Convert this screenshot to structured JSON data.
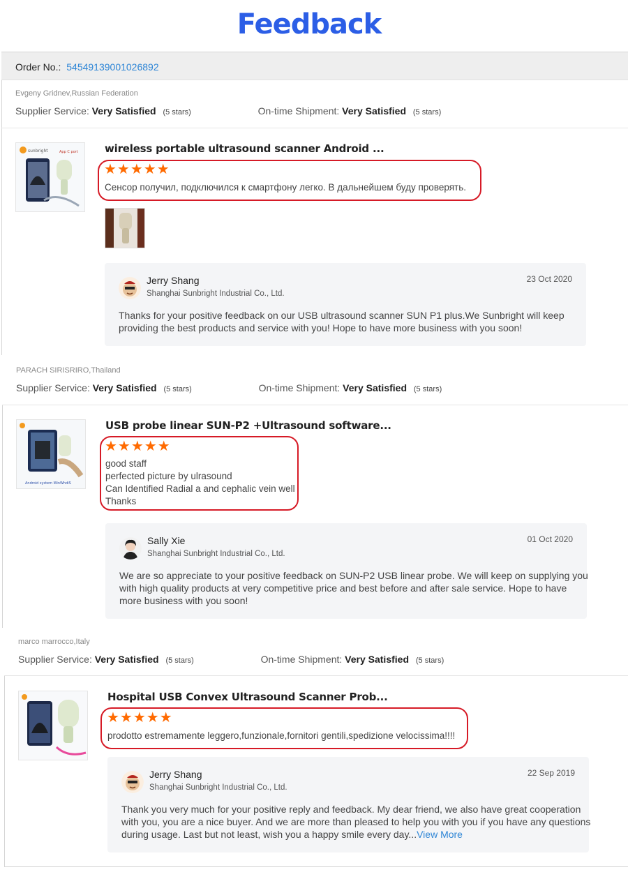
{
  "page": {
    "title": "Feedback"
  },
  "order": {
    "label": "Order No.:",
    "number": "54549139001026892"
  },
  "reviews": [
    {
      "buyer": "Evgeny Gridnev,Russian Federation",
      "supplier_service_label": "Supplier Service:",
      "supplier_service_value": "Very Satisfied",
      "supplier_service_stars": "(5 stars)",
      "shipment_label": "On-time Shipment:",
      "shipment_value": "Very Satisfied",
      "shipment_stars": "(5 stars)",
      "product_title": "wireless portable ultrasound scanner Android ...",
      "rating": "★★★★★",
      "text_lines": [
        "Сенсор получил, подключился к смартфону легко. В дальнейшем буду проверять."
      ],
      "reply": {
        "name": "Jerry Shang",
        "company": "Shanghai Sunbright Industrial Co., Ltd.",
        "date": "23 Oct 2020",
        "text_lines": [
          "Thanks for your positive feedback on our USB ultrasound scanner SUN P1 plus.We Sunbright will keep",
          "providing the best products and  service with you! Hope to have more business with you soon!"
        ]
      }
    },
    {
      "buyer": "PARACH SIRISRIRO,Thailand",
      "supplier_service_label": "Supplier Service:",
      "supplier_service_value": "Very Satisfied",
      "supplier_service_stars": "(5 stars)",
      "shipment_label": "On-time Shipment:",
      "shipment_value": "Very Satisfied",
      "shipment_stars": "(5 stars)",
      "product_title": "USB probe linear SUN-P2 +Ultrasound software...",
      "rating": "★★★★★",
      "text_lines": [
        "good staff",
        "perfected picture by ulrasound",
        "Can Identified Radial a and cephalic vein well",
        "Thanks"
      ],
      "reply": {
        "name": "Sally Xie",
        "company": "Shanghai Sunbright Industrial Co., Ltd.",
        "date": "01 Oct 2020",
        "text_lines": [
          "We are so appreciate to your positive feedback on SUN-P2 USB linear probe. We will keep on supplying you",
          "with high quality products at very competitive price and best before and after sale service. Hope to have",
          "more business with you soon!"
        ]
      }
    },
    {
      "buyer": "marco marrocco,Italy",
      "supplier_service_label": "Supplier Service:",
      "supplier_service_value": "Very Satisfied",
      "supplier_service_stars": "(5 stars)",
      "shipment_label": "On-time Shipment:",
      "shipment_value": "Very Satisfied",
      "shipment_stars": "(5 stars)",
      "product_title": "Hospital USB Convex Ultrasound Scanner Prob...",
      "rating": "★★★★★",
      "text_lines": [
        "prodotto estremamente leggero,funzionale,fornitori gentili,spedizione velocissima!!!!"
      ],
      "reply": {
        "name": "Jerry Shang",
        "company": "Shanghai Sunbright Industrial Co., Ltd.",
        "date": "22 Sep 2019",
        "text_lines": [
          "Thank you very much for your positive reply  and feedback. My dear friend, we also have great cooperation",
          "with you, you are a nice buyer. And we are more than pleased to help you with you if you have any questions",
          "during usage. Last but not least, wish you a happy smile every day..."
        ],
        "view_more": "View More"
      }
    }
  ],
  "colors": {
    "title": "#2c5ee6",
    "star": "#ff6a00",
    "highlight_box": "#d61a26",
    "link": "#2f86d6"
  }
}
